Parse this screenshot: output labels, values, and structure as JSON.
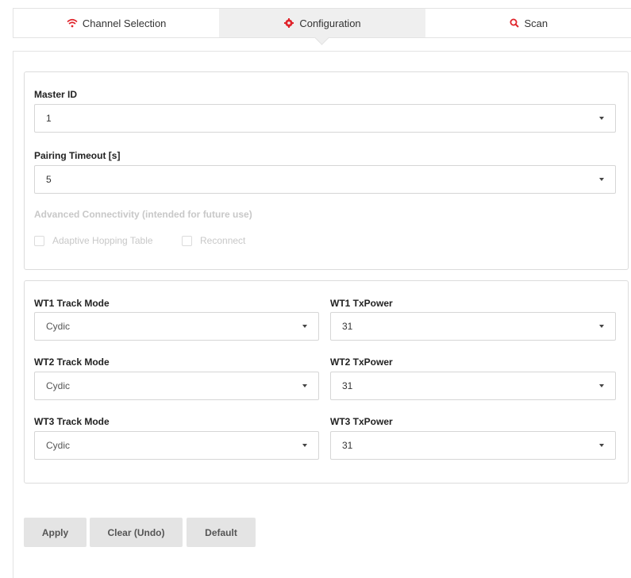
{
  "tabs": [
    {
      "label": "Channel Selection",
      "icon": "wifi-icon",
      "active": false
    },
    {
      "label": "Configuration",
      "icon": "gear-icon",
      "active": true
    },
    {
      "label": "Scan",
      "icon": "search-icon",
      "active": false
    }
  ],
  "colors": {
    "accent": "#e0242b",
    "tab_active_bg": "#efefef",
    "button_bg": "#e4e4e4"
  },
  "general": {
    "master_id": {
      "label": "Master ID",
      "value": "1"
    },
    "pairing_timeout": {
      "label": "Pairing Timeout [s]",
      "value": "5"
    },
    "advanced": {
      "label": "Advanced Connectivity (intended for future use)",
      "adaptive_hopping": {
        "label": "Adaptive Hopping Table",
        "checked": false,
        "disabled": true
      },
      "reconnect": {
        "label": "Reconnect",
        "checked": false,
        "disabled": true
      }
    }
  },
  "wt": [
    {
      "mode_label": "WT1 Track Mode",
      "mode_value": "Cydic",
      "power_label": "WT1 TxPower",
      "power_value": "31"
    },
    {
      "mode_label": "WT2 Track Mode",
      "mode_value": "Cydic",
      "power_label": "WT2 TxPower",
      "power_value": "31"
    },
    {
      "mode_label": "WT3 Track Mode",
      "mode_value": "Cydic",
      "power_label": "WT3 TxPower",
      "power_value": "31"
    }
  ],
  "buttons": {
    "apply": "Apply",
    "clear": "Clear (Undo)",
    "default": "Default"
  }
}
